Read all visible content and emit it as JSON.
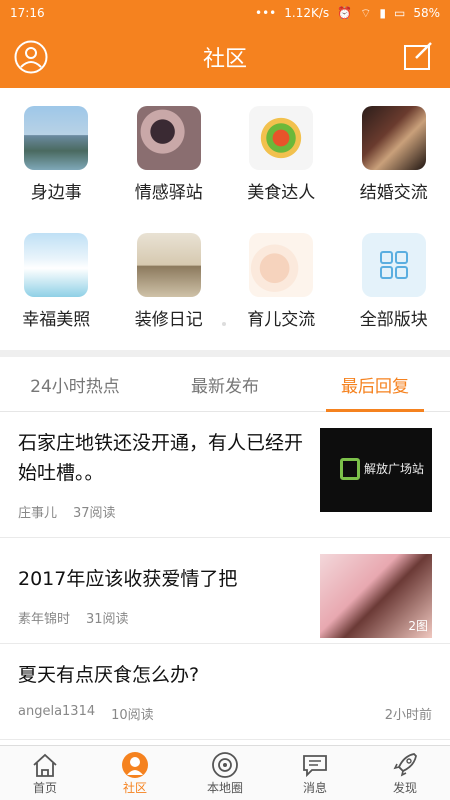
{
  "status": {
    "time": "17:16",
    "speed": "1.12K/s",
    "battery": "58%"
  },
  "header": {
    "title": "社区"
  },
  "categories": [
    {
      "label": "身边事",
      "icon": "city-photo"
    },
    {
      "label": "情感驿站",
      "icon": "girl-photo"
    },
    {
      "label": "美食达人",
      "icon": "food-photo"
    },
    {
      "label": "结婚交流",
      "icon": "wedding-photo"
    },
    {
      "label": "幸福美照",
      "icon": "couple-photo"
    },
    {
      "label": "装修日记",
      "icon": "room-photo"
    },
    {
      "label": "育儿交流",
      "icon": "baby-photo"
    },
    {
      "label": "全部版块",
      "icon": "grid-icon"
    }
  ],
  "tabs": [
    {
      "label": "24小时热点"
    },
    {
      "label": "最新发布"
    },
    {
      "label": "最后回复"
    }
  ],
  "posts": [
    {
      "title": "石家庄地铁还没开通，有人已经开始吐槽。。",
      "author": "庄事儿",
      "reads": "37阅读",
      "image_text": "解放广场站"
    },
    {
      "title": "2017年应该收获爱情了把",
      "author": "素年锦时",
      "reads": "31阅读",
      "badge": "2图"
    },
    {
      "title": "夏天有点厌食怎么办?",
      "author": "angela1314",
      "reads": "10阅读",
      "time": "2小时前"
    }
  ],
  "nav": [
    {
      "label": "首页"
    },
    {
      "label": "社区"
    },
    {
      "label": "本地圈"
    },
    {
      "label": "消息"
    },
    {
      "label": "发现"
    }
  ],
  "colors": {
    "accent": "#f5821f"
  }
}
